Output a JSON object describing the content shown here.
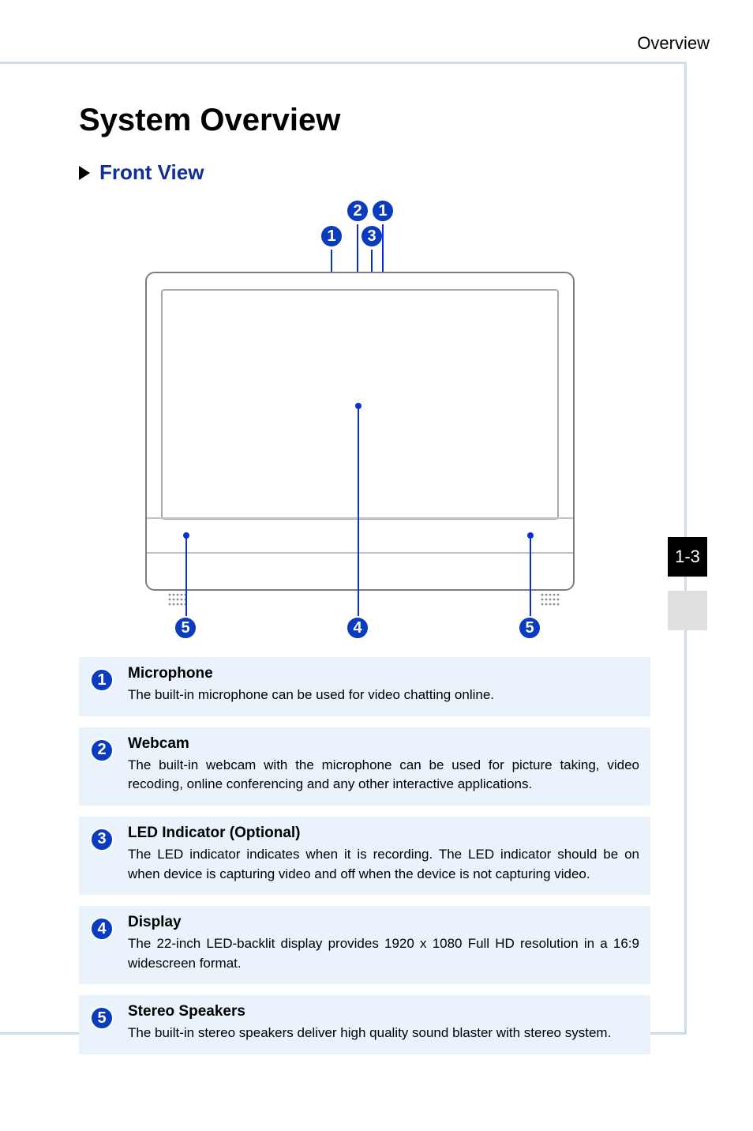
{
  "header": {
    "section_label": "Overview"
  },
  "page_number": "1-3",
  "main": {
    "title": "System Overview",
    "subsection_title": "Front View"
  },
  "callouts": {
    "top_left_mic": "1",
    "top_webcam": "2",
    "top_right_mic": "1",
    "top_led": "3",
    "display": "4",
    "speaker_left": "5",
    "speaker_right": "5"
  },
  "legend": [
    {
      "num": "1",
      "title": "Microphone",
      "desc": "The built-in microphone can be used for video chatting online."
    },
    {
      "num": "2",
      "title": "Webcam",
      "desc": "The built-in webcam with the microphone can be used for picture taking, video recoding, online conferencing and any other interactive applications."
    },
    {
      "num": "3",
      "title": "LED Indicator (Optional)",
      "desc": "The LED indicator indicates when it is recording. The LED indicator should be on when device is capturing video and off when the device is not capturing video."
    },
    {
      "num": "4",
      "title": "Display",
      "desc": "The 22-inch LED-backlit display provides 1920 x 1080 Full HD resolution in a 16:9 widescreen format."
    },
    {
      "num": "5",
      "title": "Stereo Speakers",
      "desc": "The built-in stereo speakers deliver high quality sound blaster with stereo system."
    }
  ]
}
